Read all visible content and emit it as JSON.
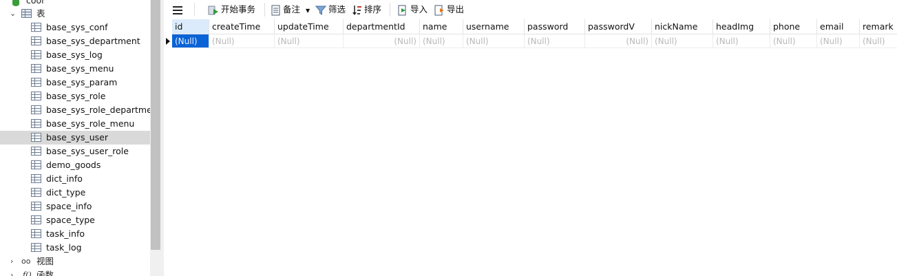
{
  "sidebar": {
    "db_name": "cool",
    "tables_group": "表",
    "tables": [
      "base_sys_conf",
      "base_sys_department",
      "base_sys_log",
      "base_sys_menu",
      "base_sys_param",
      "base_sys_role",
      "base_sys_role_department",
      "base_sys_role_menu",
      "base_sys_user",
      "base_sys_user_role",
      "demo_goods",
      "dict_info",
      "dict_type",
      "space_info",
      "space_type",
      "task_info",
      "task_log"
    ],
    "selected_table": "base_sys_user",
    "views_group": "视图",
    "functions_group": "函数"
  },
  "toolbar": {
    "menu_icon": "hamburger-icon",
    "begin_transaction": "开始事务",
    "memo": "备注",
    "filter": "筛选",
    "sort": "排序",
    "import": "导入",
    "export": "导出"
  },
  "grid": {
    "columns": [
      "id",
      "createTime",
      "updateTime",
      "departmentId",
      "name",
      "username",
      "password",
      "passwordV",
      "nickName",
      "headImg",
      "phone",
      "email",
      "remark"
    ],
    "null_text": "(Null)",
    "selected_column": "id"
  },
  "colors": {
    "selection": "#0a63d6",
    "selected_row": "#d9d9d9",
    "header_active": "#dcebfb"
  }
}
